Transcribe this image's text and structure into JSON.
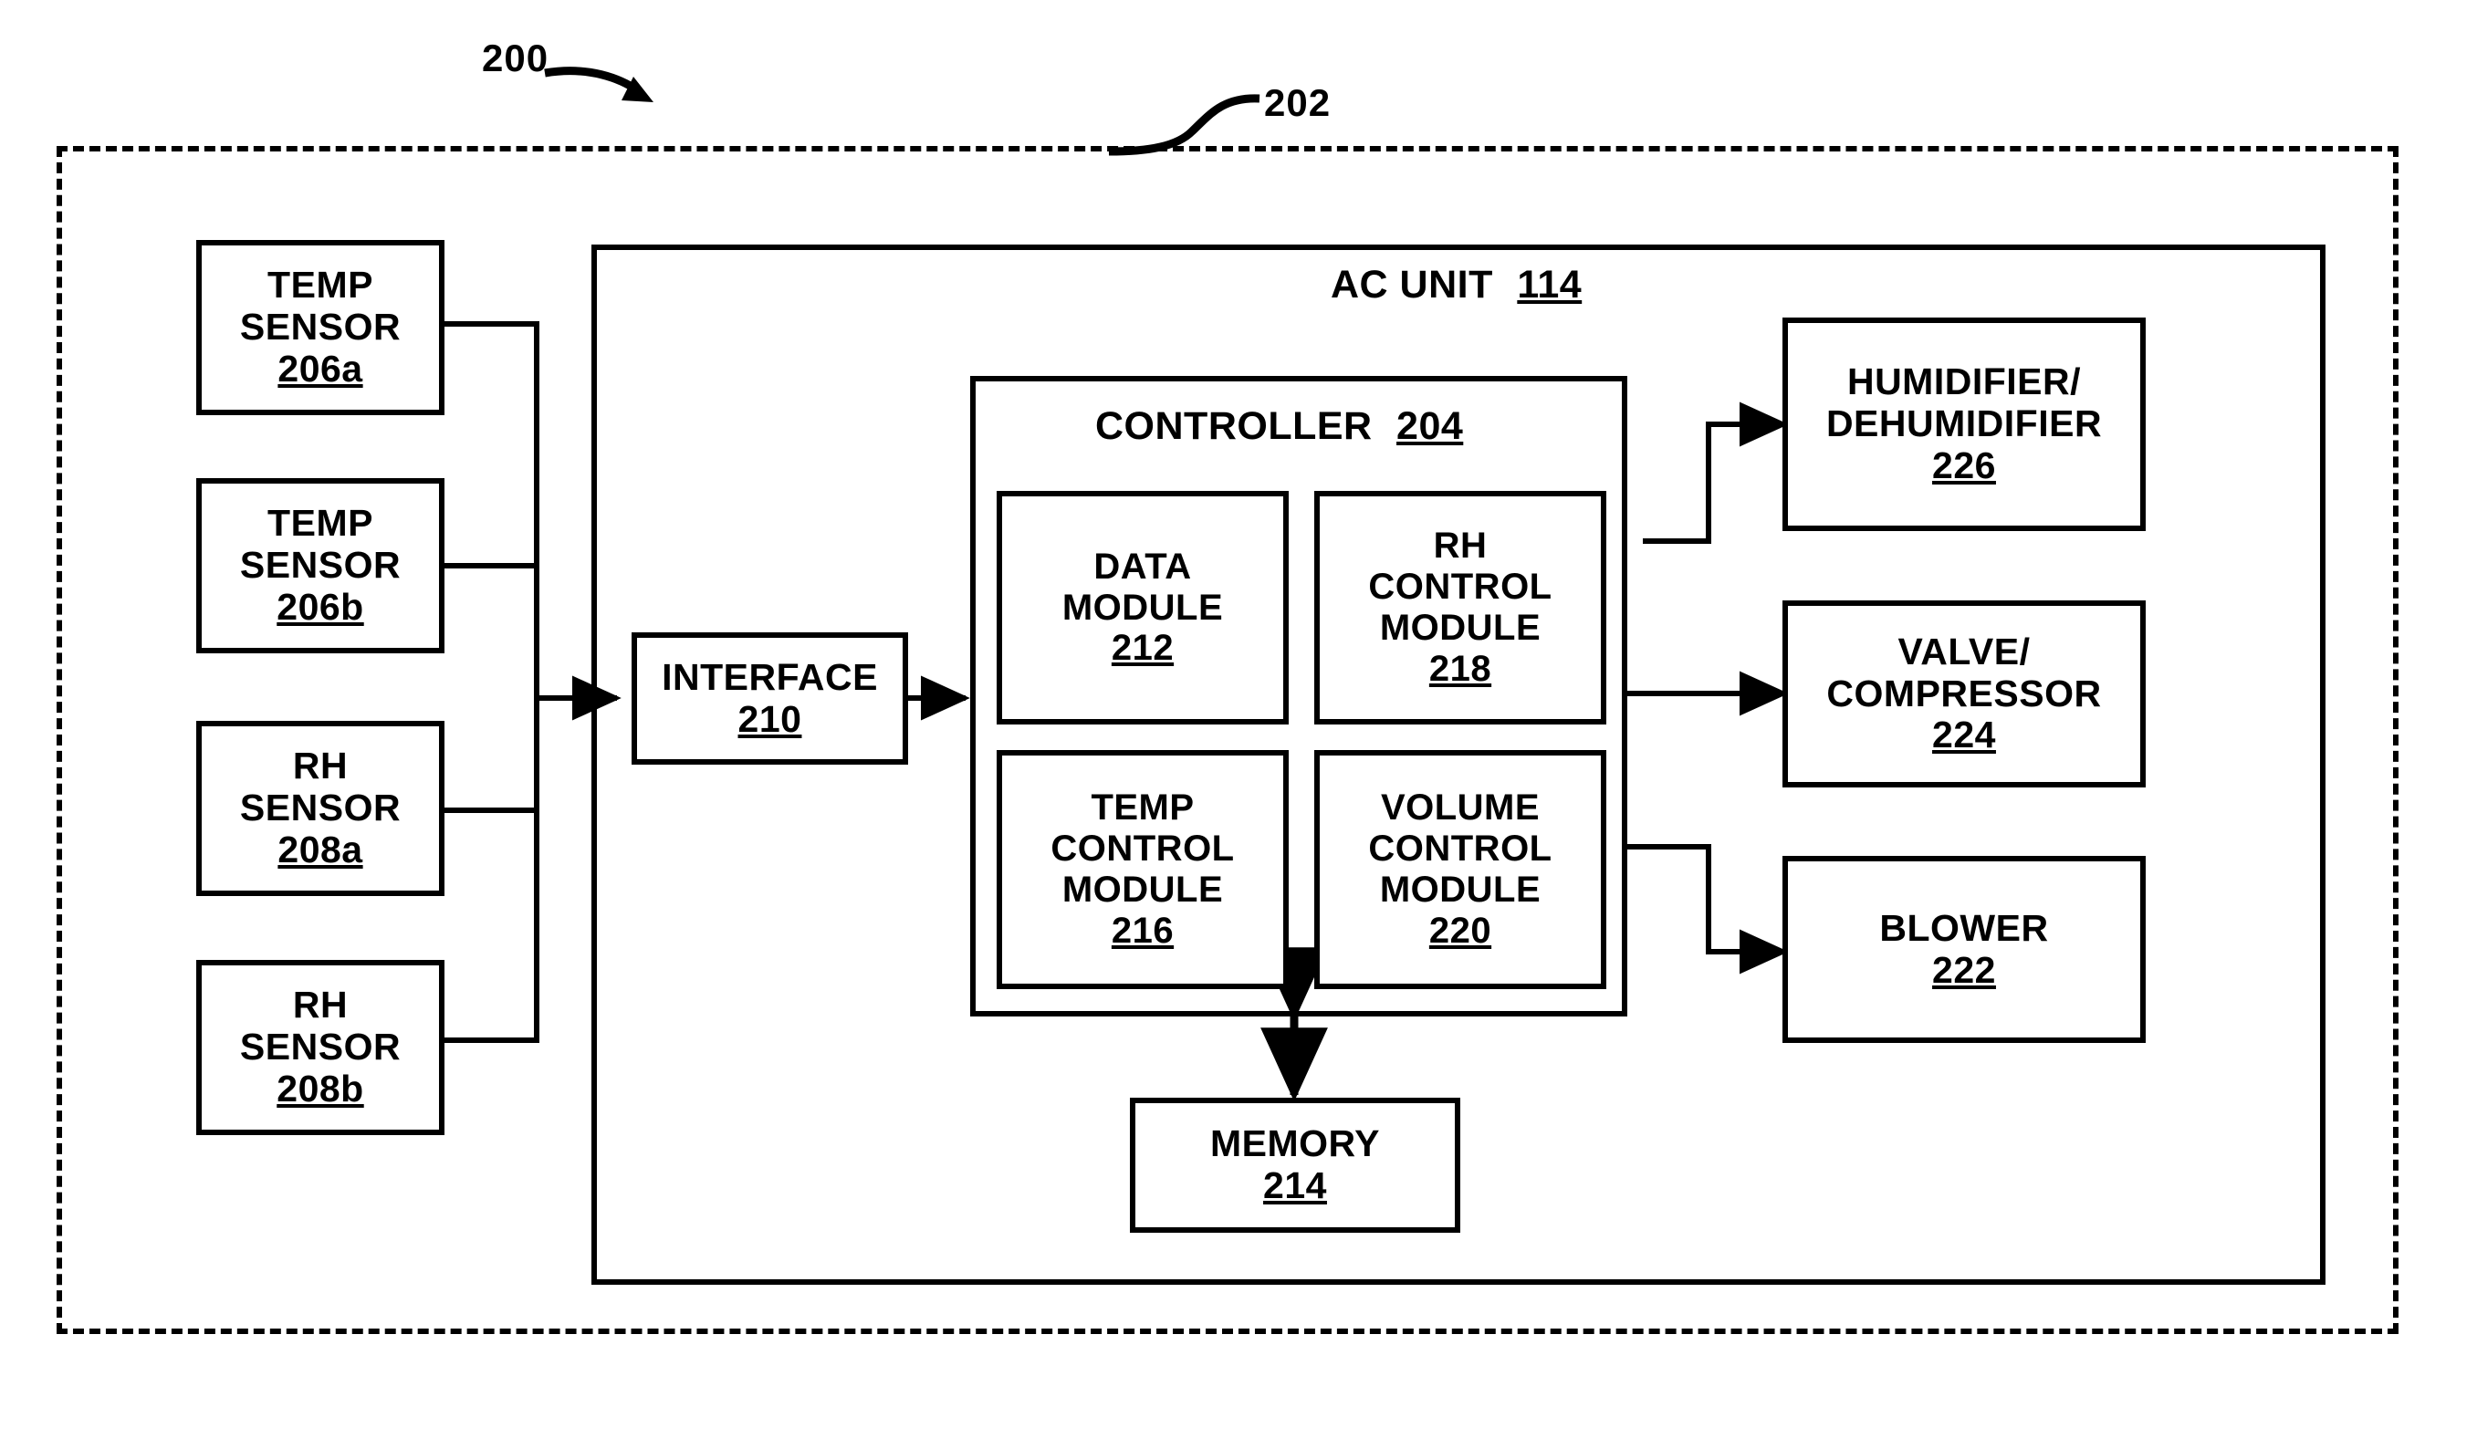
{
  "figure": {
    "system_ref": "200",
    "enclosure_ref": "202"
  },
  "enclosure": {
    "name": "dashed-system-boundary"
  },
  "ac_unit": {
    "title": "AC UNIT",
    "ref": "114"
  },
  "controller": {
    "title": "CONTROLLER",
    "ref": "204"
  },
  "sensors": [
    {
      "line1": "TEMP",
      "line2": "SENSOR",
      "ref": "206a"
    },
    {
      "line1": "TEMP",
      "line2": "SENSOR",
      "ref": "206b"
    },
    {
      "line1": "RH",
      "line2": "SENSOR",
      "ref": "208a"
    },
    {
      "line1": "RH",
      "line2": "SENSOR",
      "ref": "208b"
    }
  ],
  "interface": {
    "label": "INTERFACE",
    "ref": "210"
  },
  "modules": [
    {
      "line1": "DATA",
      "line2": "MODULE",
      "line3": "",
      "ref": "212"
    },
    {
      "line1": "RH",
      "line2": "CONTROL",
      "line3": "MODULE",
      "ref": "218"
    },
    {
      "line1": "TEMP",
      "line2": "CONTROL",
      "line3": "MODULE",
      "ref": "216"
    },
    {
      "line1": "VOLUME",
      "line2": "CONTROL",
      "line3": "MODULE",
      "ref": "220"
    }
  ],
  "memory": {
    "label": "MEMORY",
    "ref": "214"
  },
  "outputs": [
    {
      "line1": "HUMIDIFIER/",
      "line2": "DEHUMIDIFIER",
      "ref": "226"
    },
    {
      "line1": "VALVE/",
      "line2": "COMPRESSOR",
      "ref": "224"
    },
    {
      "line1": "BLOWER",
      "line2": "",
      "ref": "222"
    }
  ],
  "colors": {
    "stroke": "#000000",
    "background": "#ffffff"
  }
}
